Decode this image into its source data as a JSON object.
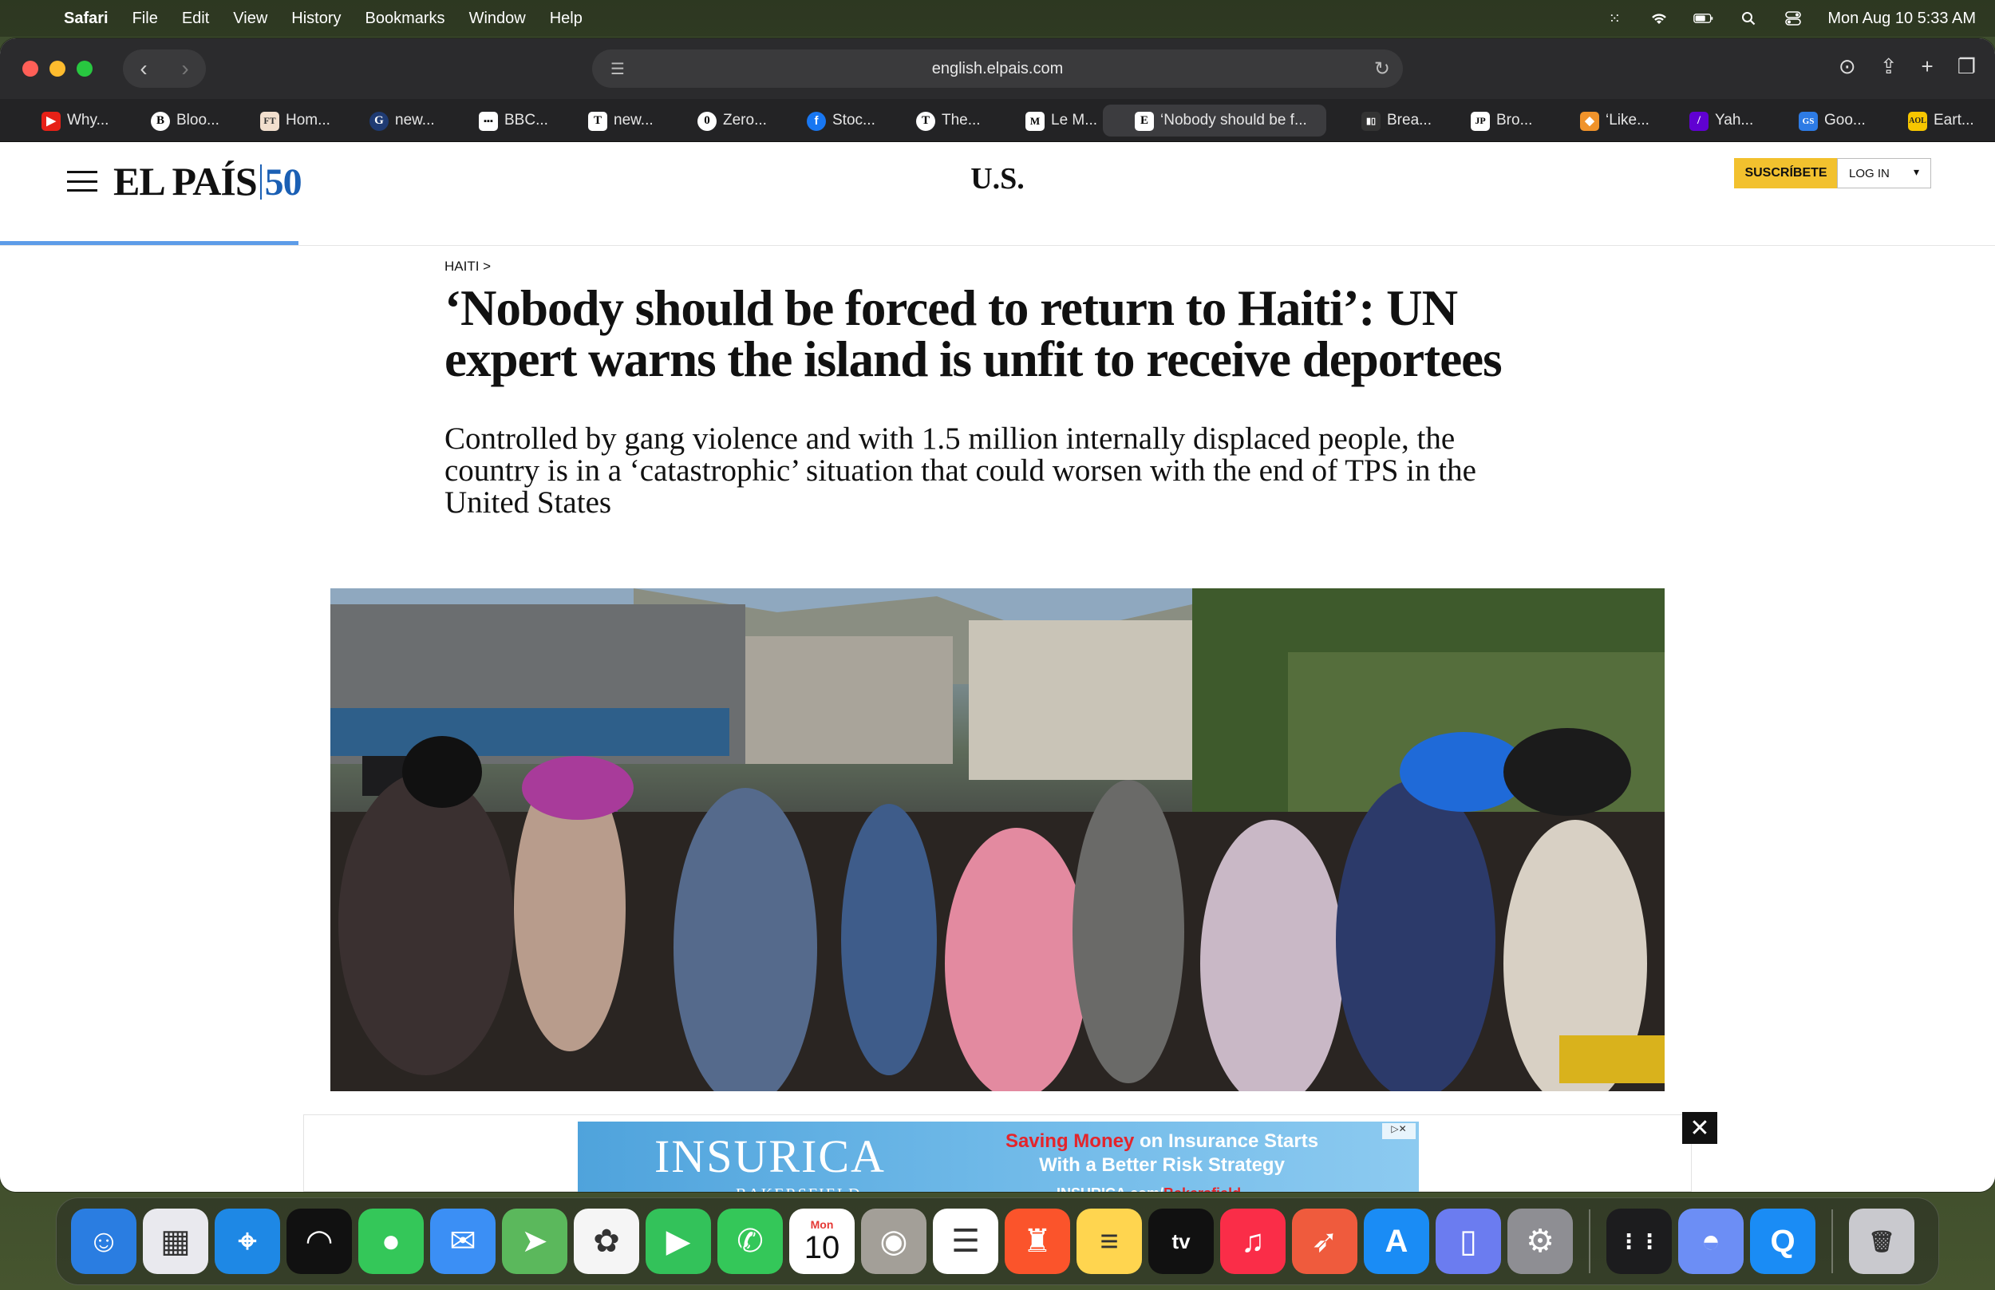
{
  "menubar": {
    "app": "Safari",
    "items": [
      "File",
      "Edit",
      "View",
      "History",
      "Bookmarks",
      "Window",
      "Help"
    ],
    "clock": "Mon Aug 10  5:33 AM"
  },
  "browser": {
    "url": "english.elpais.com",
    "tabs": [
      {
        "label": "Why...",
        "icon": "youtube-icon"
      },
      {
        "label": "Bloo...",
        "icon": "bloomberg-icon"
      },
      {
        "label": "Hom...",
        "icon": "ft-icon"
      },
      {
        "label": "new...",
        "icon": "g-icon"
      },
      {
        "label": "BBC...",
        "icon": "bbc-icon"
      },
      {
        "label": "new...",
        "icon": "t-icon"
      },
      {
        "label": "Zero...",
        "icon": "zerohedge-icon"
      },
      {
        "label": "Stoc...",
        "icon": "facebook-icon"
      },
      {
        "label": "The...",
        "icon": "nyt-icon"
      },
      {
        "label": "Le M...",
        "icon": "lemonde-icon"
      },
      {
        "label": "‘Nobody should be f...",
        "icon": "elpais-icon",
        "active": true
      },
      {
        "label": "Brea...",
        "icon": "news-icon"
      },
      {
        "label": "Bro...",
        "icon": "jp-icon"
      },
      {
        "label": "‘Like...",
        "icon": "orange-icon"
      },
      {
        "label": "Yah...",
        "icon": "yahoo-icon"
      },
      {
        "label": "Goo...",
        "icon": "google-icon"
      },
      {
        "label": "Eart...",
        "icon": "aol-icon"
      }
    ]
  },
  "site": {
    "logo_text": "EL PAÍS",
    "logo_anniversary": "50",
    "edition": "U.S.",
    "subscribe_label": "SUSCRÍBETE",
    "login_label": "LOG IN"
  },
  "article": {
    "kicker": "HAITI >",
    "headline": "‘Nobody should be forced to return to Haiti’: UN expert warns the island is unfit to receive deportees",
    "standfirst": "Controlled by gang violence and with 1.5 million internally displaced people, the country is in a ‘catastrophic’ situation that could worsen with the end of TPS in the United States"
  },
  "ad": {
    "brand": "INSURICA",
    "brand_sub": "BAKERSFIELD",
    "copy_highlight": "Saving Money",
    "copy_rest": " on Insurance Starts With a Better Risk Strategy",
    "url_main": "INSURICA.com/",
    "url_highlight": "Bakersfield",
    "close_label": "✕"
  },
  "dock": {
    "calendar_month": "Mon",
    "calendar_day": "10",
    "apps": [
      {
        "name": "finder-icon",
        "color": "#2a7de1",
        "glyph": "☺"
      },
      {
        "name": "launchpad-icon",
        "color": "#e9e9ee",
        "glyph": "▦"
      },
      {
        "name": "safari-icon",
        "color": "#1e88e5",
        "glyph": "⌖"
      },
      {
        "name": "signal-icon",
        "color": "#111111",
        "glyph": "◠"
      },
      {
        "name": "messages-icon",
        "color": "#34c759",
        "glyph": "●"
      },
      {
        "name": "mail-icon",
        "color": "#3b8ff5",
        "glyph": "✉"
      },
      {
        "name": "maps-icon",
        "color": "#5bb85c",
        "glyph": "➤"
      },
      {
        "name": "photos-icon",
        "color": "#f5f5f5",
        "glyph": "✿"
      },
      {
        "name": "facetime-icon",
        "color": "#33c25a",
        "glyph": "▶"
      },
      {
        "name": "phone-icon",
        "color": "#34c759",
        "glyph": "✆"
      },
      {
        "name": "calendar-icon",
        "color": "#ffffff",
        "glyph": ""
      },
      {
        "name": "contacts-icon",
        "color": "#a39f98",
        "glyph": "◉"
      },
      {
        "name": "reminders-icon",
        "color": "#ffffff",
        "glyph": "☰"
      },
      {
        "name": "brave-icon",
        "color": "#fb542b",
        "glyph": "♜"
      },
      {
        "name": "notes-icon",
        "color": "#ffd54f",
        "glyph": "≡"
      },
      {
        "name": "appletv-icon",
        "color": "#111111",
        "glyph": "tv"
      },
      {
        "name": "music-icon",
        "color": "#fa2d48",
        "glyph": "♫"
      },
      {
        "name": "rocket-icon",
        "color": "#ef5b3d",
        "glyph": "➶"
      },
      {
        "name": "appstore-icon",
        "color": "#1a8cf5",
        "glyph": "A"
      },
      {
        "name": "simulator-icon",
        "color": "#6b7cf0",
        "glyph": "▯"
      },
      {
        "name": "settings-icon",
        "color": "#8e8e93",
        "glyph": "⚙"
      },
      {
        "name": "apps-grid-icon",
        "color": "#1c1c1e",
        "glyph": "⋮⋮"
      },
      {
        "name": "bluetooth-app-icon",
        "color": "#6c8ef5",
        "glyph": "◓"
      },
      {
        "name": "q-app-icon",
        "color": "#1a8cf5",
        "glyph": "Q"
      },
      {
        "name": "trash-icon",
        "color": "#c9c9ce",
        "glyph": "🗑"
      }
    ]
  }
}
